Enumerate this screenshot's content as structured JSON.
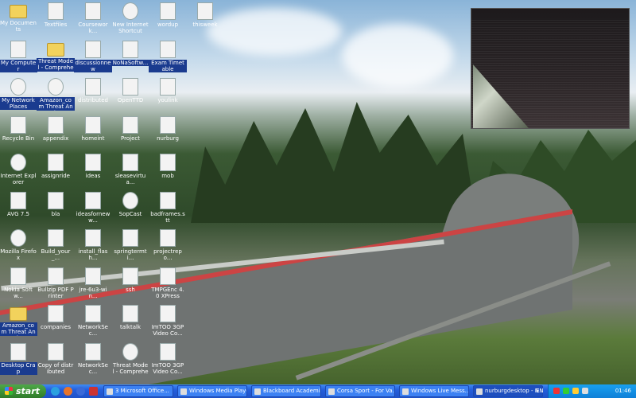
{
  "desktop": {
    "icons": [
      {
        "label": "My Documents",
        "icon": "folder-docs-icon",
        "kind": "folder"
      },
      {
        "label": "Textfiles",
        "icon": "text-file-icon",
        "kind": "doc"
      },
      {
        "label": "Coursework...",
        "icon": "text-file-icon",
        "kind": "doc"
      },
      {
        "label": "New Internet Shortcut",
        "icon": "firefox-shortcut-icon",
        "kind": "round"
      },
      {
        "label": "wordup",
        "icon": "text-file-icon",
        "kind": "doc"
      },
      {
        "label": "thisweek",
        "icon": "text-file-icon",
        "kind": "doc"
      },
      {
        "label": "My Computer",
        "icon": "computer-icon",
        "kind": "doc"
      },
      {
        "label": "Threat Model - Comprehen...",
        "icon": "folder-icon",
        "kind": "folder"
      },
      {
        "label": "discussionnew",
        "icon": "text-file-icon",
        "kind": "doc"
      },
      {
        "label": "NoNaSoftw...",
        "icon": "download-icon",
        "kind": "doc"
      },
      {
        "label": "Exam Timetable",
        "icon": "text-file-icon",
        "kind": "doc"
      },
      {
        "label": "My Network Places",
        "icon": "network-places-icon",
        "kind": "round"
      },
      {
        "label": "Amazon_com Threat Anal...",
        "icon": "firefox-icon",
        "kind": "round"
      },
      {
        "label": "distributed",
        "icon": "text-file-icon",
        "kind": "doc"
      },
      {
        "label": "OpenTTD",
        "icon": "openttd-icon",
        "kind": "doc"
      },
      {
        "label": "youlink",
        "icon": "text-file-icon",
        "kind": "doc"
      },
      {
        "label": "Recycle Bin",
        "icon": "recycle-bin-icon",
        "kind": "doc"
      },
      {
        "label": "appendix",
        "icon": "text-file-icon",
        "kind": "doc"
      },
      {
        "label": "homeint",
        "icon": "text-file-icon",
        "kind": "doc"
      },
      {
        "label": "Project",
        "icon": "text-file-icon",
        "kind": "doc"
      },
      {
        "label": "nurburg",
        "icon": "text-file-icon",
        "kind": "doc"
      },
      {
        "label": "Internet Explorer",
        "icon": "internet-explorer-icon",
        "kind": "round"
      },
      {
        "label": "assignride",
        "icon": "text-file-icon",
        "kind": "doc"
      },
      {
        "label": "ideas",
        "icon": "text-file-icon",
        "kind": "doc"
      },
      {
        "label": "sleasevirtua...",
        "icon": "text-file-icon",
        "kind": "doc"
      },
      {
        "label": "mob",
        "icon": "text-file-icon",
        "kind": "doc"
      },
      {
        "label": "AVG 7.5",
        "icon": "avg-icon",
        "kind": "doc"
      },
      {
        "label": "bla",
        "icon": "pdf-icon",
        "kind": "doc"
      },
      {
        "label": "ideasforneww...",
        "icon": "text-file-icon",
        "kind": "doc"
      },
      {
        "label": "SopCast",
        "icon": "sopcast-icon",
        "kind": "round"
      },
      {
        "label": "badframes.stt",
        "icon": "text-file-icon",
        "kind": "doc"
      },
      {
        "label": "Mozilla Firefox",
        "icon": "firefox-icon",
        "kind": "round"
      },
      {
        "label": "Build_your_...",
        "icon": "pdf-icon",
        "kind": "doc"
      },
      {
        "label": "install_flash...",
        "icon": "flash-installer-icon",
        "kind": "doc"
      },
      {
        "label": "springtermti...",
        "icon": "text-file-icon",
        "kind": "doc"
      },
      {
        "label": "projectrepo...",
        "icon": "text-file-icon",
        "kind": "doc"
      },
      {
        "label": "Nokia Softw...",
        "icon": "nokia-icon",
        "kind": "doc"
      },
      {
        "label": "Bullzip PDF Printer",
        "icon": "pdf-printer-icon",
        "kind": "doc"
      },
      {
        "label": "jre-6u3-win...",
        "icon": "java-icon",
        "kind": "doc"
      },
      {
        "label": "ssh",
        "icon": "text-file-icon",
        "kind": "doc"
      },
      {
        "label": "TMPGEnc 4.0 XPress",
        "icon": "tmpgenc-icon",
        "kind": "doc"
      },
      {
        "label": "Amazon_com Threat Anal...",
        "icon": "folder-icon",
        "kind": "folder"
      },
      {
        "label": "companies",
        "icon": "text-file-icon",
        "kind": "doc"
      },
      {
        "label": "NetworkSec...",
        "icon": "text-file-icon",
        "kind": "doc"
      },
      {
        "label": "talktalk",
        "icon": "text-file-icon",
        "kind": "doc"
      },
      {
        "label": "ImTOO 3GP Video Co...",
        "icon": "imtoo-icon",
        "kind": "doc"
      },
      {
        "label": "Desktop Crap",
        "icon": "desktop-icon",
        "kind": "doc"
      },
      {
        "label": "Copy of distributed",
        "icon": "text-file-icon",
        "kind": "doc"
      },
      {
        "label": "NetworkSec...",
        "icon": "text-file-icon",
        "kind": "doc"
      },
      {
        "label": "Threat Model - Comprehen...",
        "icon": "firefox-icon",
        "kind": "round"
      },
      {
        "label": "ImTOO 3GP Video Co...",
        "icon": "imtoo-icon",
        "kind": "doc"
      }
    ]
  },
  "taskbar": {
    "start_label": "start",
    "tasks": [
      {
        "label": "3 Microsoft Office...",
        "icon": "office-icon"
      },
      {
        "label": "Windows Media Player",
        "icon": "media-player-icon"
      },
      {
        "label": "Blackboard Academi...",
        "icon": "browser-icon"
      },
      {
        "label": "Corsa Sport - For Va...",
        "icon": "browser-icon"
      },
      {
        "label": "Windows Live Mess...",
        "icon": "messenger-icon"
      },
      {
        "label": "nurburgdesktop - N...",
        "icon": "notepad-icon"
      }
    ],
    "tray": {
      "lang": "EN",
      "clock": "01:46"
    }
  }
}
